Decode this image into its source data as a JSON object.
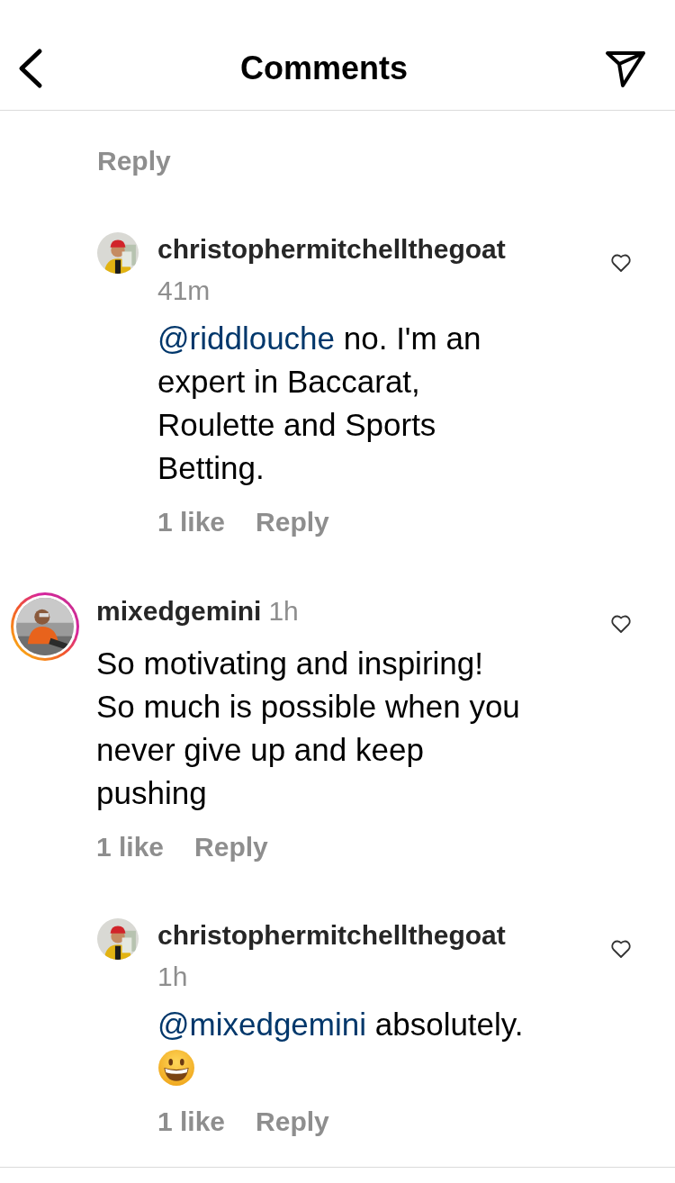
{
  "header": {
    "title": "Comments"
  },
  "previous": {
    "reply_label": "Reply"
  },
  "comments": [
    {
      "kind": "reply",
      "user": "christophermitchellthegoat",
      "time": "41m",
      "mention": "@riddlouche",
      "text": "no. I'm an expert in Baccarat, Roulette and Sports Betting.",
      "emoji": false,
      "likes": "1 like",
      "reply_label": "Reply",
      "story": false
    },
    {
      "kind": "comment",
      "user": "mixedgemini",
      "time": "1h",
      "text": "So motivating and inspiring! So much is possible when you never give up and keep pushing",
      "emoji": false,
      "likes": "1 like",
      "reply_label": "Reply",
      "story": true
    },
    {
      "kind": "reply",
      "user": "christophermitchellthegoat",
      "time": "1h",
      "mention": "@mixedgemini",
      "text": "absolutely.",
      "emoji": true,
      "likes": "1 like",
      "reply_label": "Reply",
      "story": false
    }
  ]
}
